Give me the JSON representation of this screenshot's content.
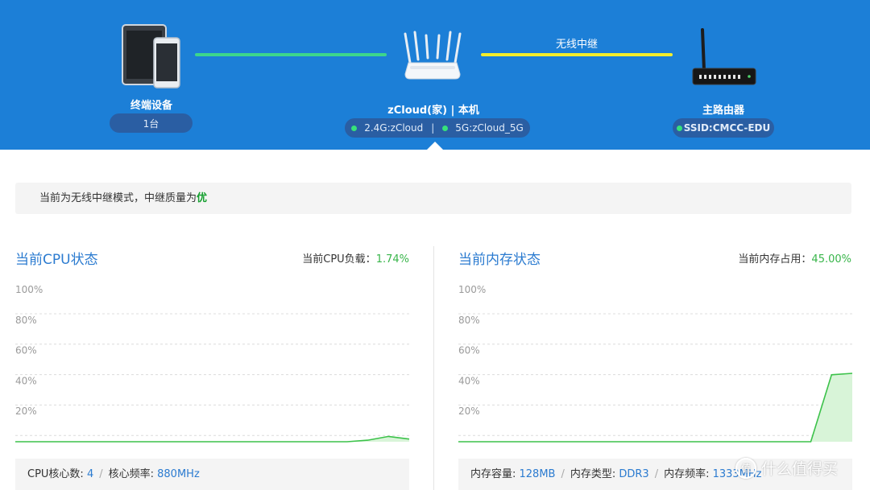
{
  "topology": {
    "terminal": {
      "label": "终端设备",
      "count": "1台"
    },
    "link_label": "无线中继",
    "router": {
      "label": "zCloud(家) | 本机",
      "band_24": "2.4G:zCloud",
      "band_5": "5G:zCloud_5G",
      "separator": "|"
    },
    "main_router": {
      "label": "主路由器",
      "ssid": "SSID:CMCC-EDU"
    }
  },
  "banner": {
    "prefix": "当前为无线中继模式，中继质量为",
    "quality": "优"
  },
  "cpu": {
    "title": "当前CPU状态",
    "load_label": "当前CPU负载：",
    "load_value": "1.74%",
    "footer": {
      "cores_label": "CPU核心数: ",
      "cores_value": "4",
      "sep": "/",
      "freq_label": "核心频率: ",
      "freq_value": "880MHz"
    }
  },
  "memory": {
    "title": "当前内存状态",
    "usage_label": "当前内存占用：",
    "usage_value": "45.00%",
    "footer": {
      "capacity_label": "内存容量: ",
      "capacity_value": "128MB",
      "sep": "/",
      "type_label": "内存类型: ",
      "type_value": "DDR3",
      "freq_label": "内存频率: ",
      "freq_value": "1333MHz"
    }
  },
  "watermark": {
    "text": "什么值得买",
    "mark": "值"
  },
  "colors": {
    "topbar": "#1c7fd7",
    "link_wired": "#3dd68c",
    "link_wireless": "#f3ee2b",
    "accent_blue": "#2b7bd0",
    "ok_green": "#38b54a",
    "chart_line": "#3cc24a",
    "chart_fill": "#d8f4d8"
  },
  "chart_data": [
    {
      "type": "area",
      "name": "cpu",
      "y_ticks": [
        "100%",
        "80%",
        "60%",
        "40%",
        "20%"
      ],
      "ylim": [
        0,
        100
      ],
      "grid": true,
      "x": [
        0,
        1,
        2,
        3,
        4,
        5,
        6,
        7,
        8,
        9,
        10,
        11,
        12,
        13,
        14,
        15,
        16,
        17,
        18,
        19
      ],
      "values": [
        0,
        0,
        0,
        0,
        0,
        0,
        0,
        0,
        0,
        0,
        0,
        0,
        0,
        0,
        0,
        0,
        0,
        1,
        3.5,
        1.74
      ]
    },
    {
      "type": "area",
      "name": "memory",
      "y_ticks": [
        "100%",
        "80%",
        "60%",
        "40%",
        "20%"
      ],
      "ylim": [
        0,
        100
      ],
      "grid": true,
      "x": [
        0,
        1,
        2,
        3,
        4,
        5,
        6,
        7,
        8,
        9,
        10,
        11,
        12,
        13,
        14,
        15,
        16,
        17,
        18,
        19
      ],
      "values": [
        0,
        0,
        0,
        0,
        0,
        0,
        0,
        0,
        0,
        0,
        0,
        0,
        0,
        0,
        0,
        0,
        0,
        0,
        44,
        45
      ]
    }
  ]
}
